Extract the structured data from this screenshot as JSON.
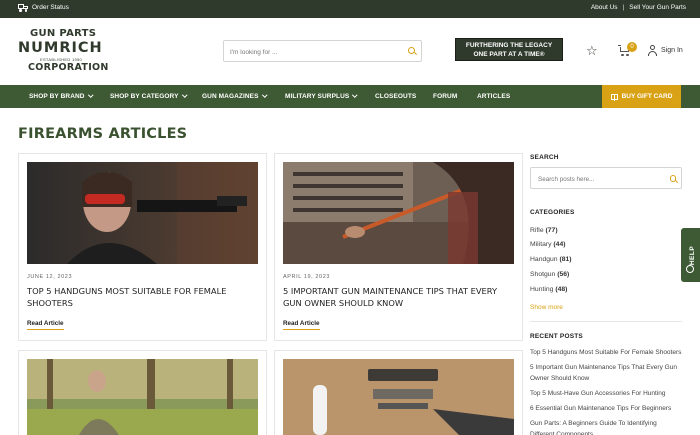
{
  "topbar": {
    "order_status": "Order Status",
    "about": "About Us",
    "separator": "|",
    "sell": "Sell Your Gun Parts"
  },
  "logo": {
    "line1": "GUN PARTS",
    "line2": "NUMRICH",
    "line3": "ESTABLISHED 1950",
    "line4": "CORPORATION"
  },
  "search": {
    "placeholder": "I'm looking for ..."
  },
  "banner": {
    "line1": "FURTHERING THE LEGACY",
    "line2": "ONE PART AT A TIME®"
  },
  "header": {
    "cart_count": "0",
    "signin": "Sign In"
  },
  "nav": {
    "items": [
      "SHOP BY BRAND",
      "SHOP BY CATEGORY",
      "GUN MAGAZINES",
      "MILITARY SURPLUS",
      "CLOSEOUTS",
      "FORUM",
      "ARTICLES"
    ],
    "gift_card": "BUY GIFT CARD"
  },
  "page": {
    "title": "FIREARMS ARTICLES"
  },
  "articles": [
    {
      "date": "JUNE 12, 2023",
      "title": "Top 5 Handguns Most Suitable For Female Shooters",
      "read": "Read Article"
    },
    {
      "date": "APRIL 19, 2023",
      "title": "5 Important Gun Maintenance Tips That Every Gun Owner Should Know",
      "read": "Read Article"
    }
  ],
  "sidebar": {
    "search_heading": "SEARCH",
    "search_placeholder": "Search posts here...",
    "categories_heading": "CATEGORIES",
    "categories": [
      {
        "name": "Rifle",
        "count": "(77)"
      },
      {
        "name": "Military",
        "count": "(44)"
      },
      {
        "name": "Handgun",
        "count": "(81)"
      },
      {
        "name": "Shotgun",
        "count": "(56)"
      },
      {
        "name": "Hunting",
        "count": "(48)"
      }
    ],
    "show_more": "Show more",
    "recent_heading": "RECENT POSTS",
    "recent": [
      "Top 5 Handguns Most Suitable For Female Shooters",
      "5 Important Gun Maintenance Tips That Every Gun Owner Should Know",
      "Top 5 Must-Have Gun Accessories For Hunting",
      "6 Essential Gun Maintenance Tips For Beginners",
      "Gun Parts: A Beginners Guide To Identifying Different Components"
    ]
  },
  "help": {
    "label": "HELP"
  },
  "colors": {
    "dark_green": "#2f3a2c",
    "nav_green": "#3e5a34",
    "gold": "#d9a114",
    "title_green": "#3a5230"
  }
}
